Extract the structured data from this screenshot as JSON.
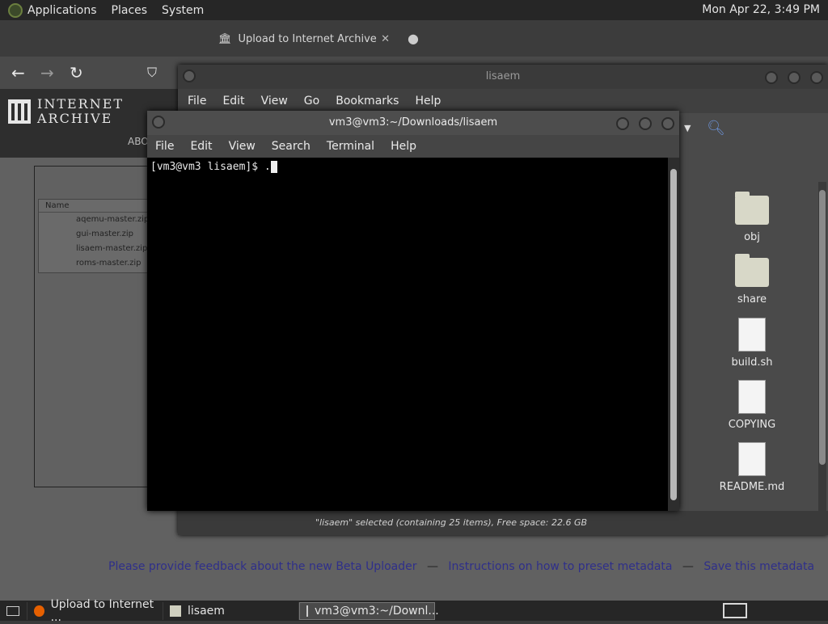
{
  "top_panel": {
    "menus": [
      "Applications",
      "Places",
      "System"
    ],
    "clock": "Mon Apr 22,  3:49 PM"
  },
  "browser": {
    "tab_title": "Upload to Internet Archive",
    "logo_line1": "INTERNET",
    "logo_line2": "ARCHIVE",
    "nav_partial": "ABO",
    "file_list_header": "Name",
    "files": [
      "aqemu-master.zip",
      "gui-master.zip",
      "lisaem-master.zip",
      "roms-master.zip"
    ],
    "feedback_links": [
      "Please provide feedback about the new Beta Uploader",
      "Instructions on how to preset metadata",
      "Save this metadata"
    ],
    "separator": "—"
  },
  "file_manager": {
    "title": "lisaem",
    "menus": [
      "File",
      "Edit",
      "View",
      "Go",
      "Bookmarks",
      "Help"
    ],
    "items": [
      {
        "label": "obj",
        "icon": "folder-icon"
      },
      {
        "label": "share",
        "icon": "folder-icon"
      },
      {
        "label": "build.sh",
        "icon": "script-file-icon"
      },
      {
        "label": "COPYING",
        "icon": "text-file-icon"
      },
      {
        "label": "README.md",
        "icon": "markdown-file-icon"
      }
    ],
    "status": "\"lisaem\" selected (containing 25 items), Free space: 22.6 GB"
  },
  "terminal": {
    "title": "vm3@vm3:~/Downloads/lisaem",
    "menus": [
      "File",
      "Edit",
      "View",
      "Search",
      "Terminal",
      "Help"
    ],
    "prompt": "[vm3@vm3 lisaem]$ ."
  },
  "taskbar": {
    "tasks": [
      {
        "label": "Upload to Internet ...",
        "icon": "firefox-icon"
      },
      {
        "label": "lisaem",
        "icon": "folder-icon"
      },
      {
        "label": "vm3@vm3:~/Downl...",
        "icon": "terminal-icon"
      }
    ]
  }
}
